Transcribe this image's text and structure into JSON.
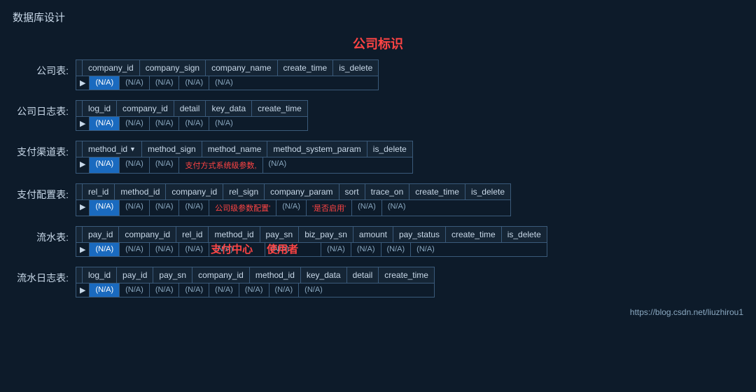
{
  "page": {
    "title": "数据库设计",
    "center_label": "公司标识",
    "footer_link": "https://blog.csdn.net/liuzhirou1"
  },
  "tables": {
    "company": {
      "label": "公司表:",
      "headers": [
        "company_id",
        "company_sign",
        "company_name",
        "create_time",
        "is_delete"
      ],
      "data": [
        "(N/A)",
        "(N/A)",
        "(N/A)",
        "(N/A)",
        "(N/A)"
      ],
      "highlighted_col": 0
    },
    "company_log": {
      "label": "公司日志表:",
      "headers": [
        "log_id",
        "company_id",
        "detail",
        "key_data",
        "create_time"
      ],
      "data": [
        "(N/A)",
        "(N/A)",
        "(N/A)",
        "(N/A)",
        "(N/A)"
      ],
      "highlighted_col": 0
    },
    "pay_channel": {
      "label": "支付渠道表:",
      "headers": [
        "method_id",
        "method_sign",
        "method_name",
        "method_system_param",
        "is_delete"
      ],
      "data": [
        "(N/A)",
        "(N/A)",
        "(N/A)",
        "支付方式系统级参数,",
        "(N/A)"
      ],
      "highlighted_col": 0,
      "has_sort": true
    },
    "pay_config": {
      "label": "支付配置表:",
      "headers": [
        "rel_id",
        "method_id",
        "company_id",
        "rel_sign",
        "company_param",
        "sort",
        "trace_on",
        "create_time",
        "is_delete"
      ],
      "data": [
        "(N/A)",
        "(N/A)",
        "(N/A)",
        "(N/A)",
        "公司级参数配置'",
        "(N/A)",
        "'是否启用'",
        "(N/A)",
        "(N/A)"
      ],
      "highlighted_col": 0
    },
    "flow": {
      "label": "流水表:",
      "headers": [
        "pay_id",
        "company_id",
        "rel_id",
        "method_id",
        "pay_sn",
        "biz_pay_sn",
        "amount",
        "pay_status",
        "create_time",
        "is_delete"
      ],
      "data": [
        "(N/A)",
        "(N/A)",
        "(N/A)",
        "(N/A)",
        "(N/A)",
        "(N/A)",
        "(N/A)",
        "(N/A)",
        "(N/A)",
        "(N/A)"
      ],
      "highlighted_col": 0,
      "overlay_zhifu": "支付中心",
      "overlay_yonghu": "使用者"
    },
    "flow_log": {
      "label": "流水日志表:",
      "headers": [
        "log_id",
        "pay_id",
        "pay_sn",
        "company_id",
        "method_id",
        "key_data",
        "detail",
        "create_time"
      ],
      "data": [
        "(N/A)",
        "(N/A)",
        "(N/A)",
        "(N/A)",
        "(N/A)",
        "(N/A)",
        "(N/A)",
        "(N/A)"
      ],
      "highlighted_col": 0
    }
  }
}
